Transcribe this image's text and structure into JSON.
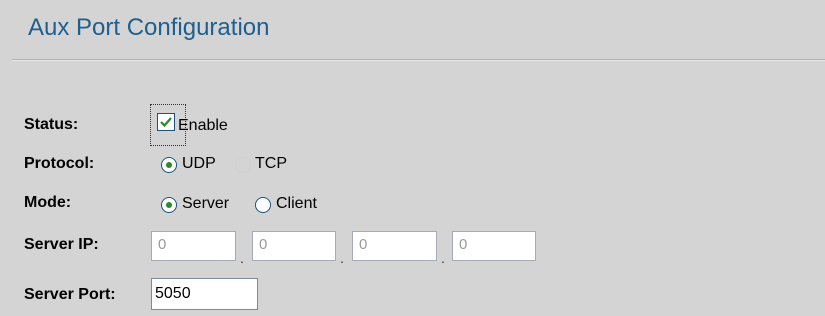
{
  "page": {
    "title": "Aux Port Configuration"
  },
  "status": {
    "label": "Status:",
    "checkbox_label": "Enable",
    "enabled": true
  },
  "protocol": {
    "label": "Protocol:",
    "options": [
      {
        "label": "UDP",
        "selected": true,
        "disabled": false
      },
      {
        "label": "TCP",
        "selected": false,
        "disabled": true
      }
    ]
  },
  "mode": {
    "label": "Mode:",
    "options": [
      {
        "label": "Server",
        "selected": true
      },
      {
        "label": "Client",
        "selected": false
      }
    ]
  },
  "server_ip": {
    "label": "Server IP:",
    "octets": [
      "0",
      "0",
      "0",
      "0"
    ],
    "separator": "."
  },
  "server_port": {
    "label": "Server Port:",
    "value": "5050"
  },
  "colors": {
    "background": "#d4d4d4",
    "title": "#1f5f8f",
    "checkmark": "#2a8a2a"
  }
}
